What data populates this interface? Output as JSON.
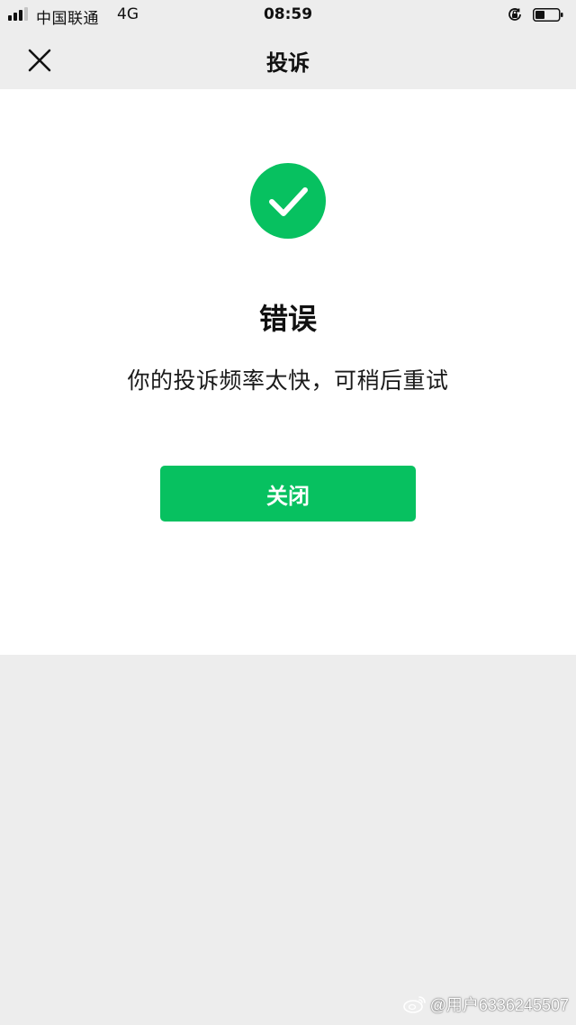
{
  "status_bar": {
    "carrier": "中国联通",
    "network": "4G",
    "time": "08:59"
  },
  "nav": {
    "title": "投诉",
    "close_icon": "close-icon"
  },
  "result": {
    "icon": "success-check-icon",
    "title": "错误",
    "description": "你的投诉频率太快，可稍后重试",
    "button_label": "关闭"
  },
  "watermark": {
    "text": "@用户6336245507"
  },
  "colors": {
    "accent": "#07c160",
    "page_bg": "#ededed",
    "card_bg": "#ffffff"
  }
}
